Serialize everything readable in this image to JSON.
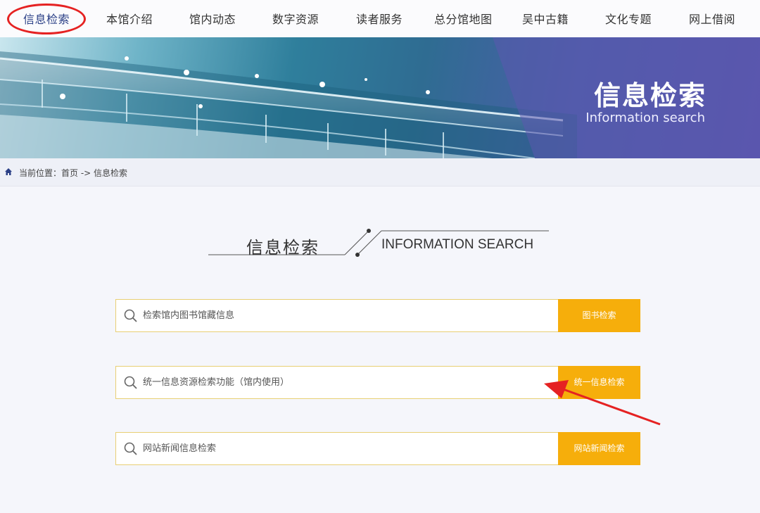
{
  "nav": {
    "items": [
      "信息检索",
      "本馆介绍",
      "馆内动态",
      "数字资源",
      "读者服务",
      "总分馆地图",
      "吴中古籍",
      "文化专题",
      "网上借阅"
    ]
  },
  "banner": {
    "title": "信息检索",
    "subtitle": "Information search"
  },
  "breadcrumb": {
    "icon": "home-icon",
    "text": "当前位置：首页 -> 信息检索"
  },
  "section": {
    "title_cn": "信息检索",
    "title_en": "INFORMATION SEARCH"
  },
  "search": [
    {
      "placeholder": "检索馆内图书馆藏信息",
      "button": "图书检索"
    },
    {
      "placeholder": "统一信息资源检索功能（馆内使用）",
      "button": "统一信息检索"
    },
    {
      "placeholder": "网站新闻信息检索",
      "button": "网站新闻检索"
    }
  ],
  "colors": {
    "accent": "#f6ae0b",
    "highlight": "#e52222",
    "nav_active": "#2a3f86"
  }
}
